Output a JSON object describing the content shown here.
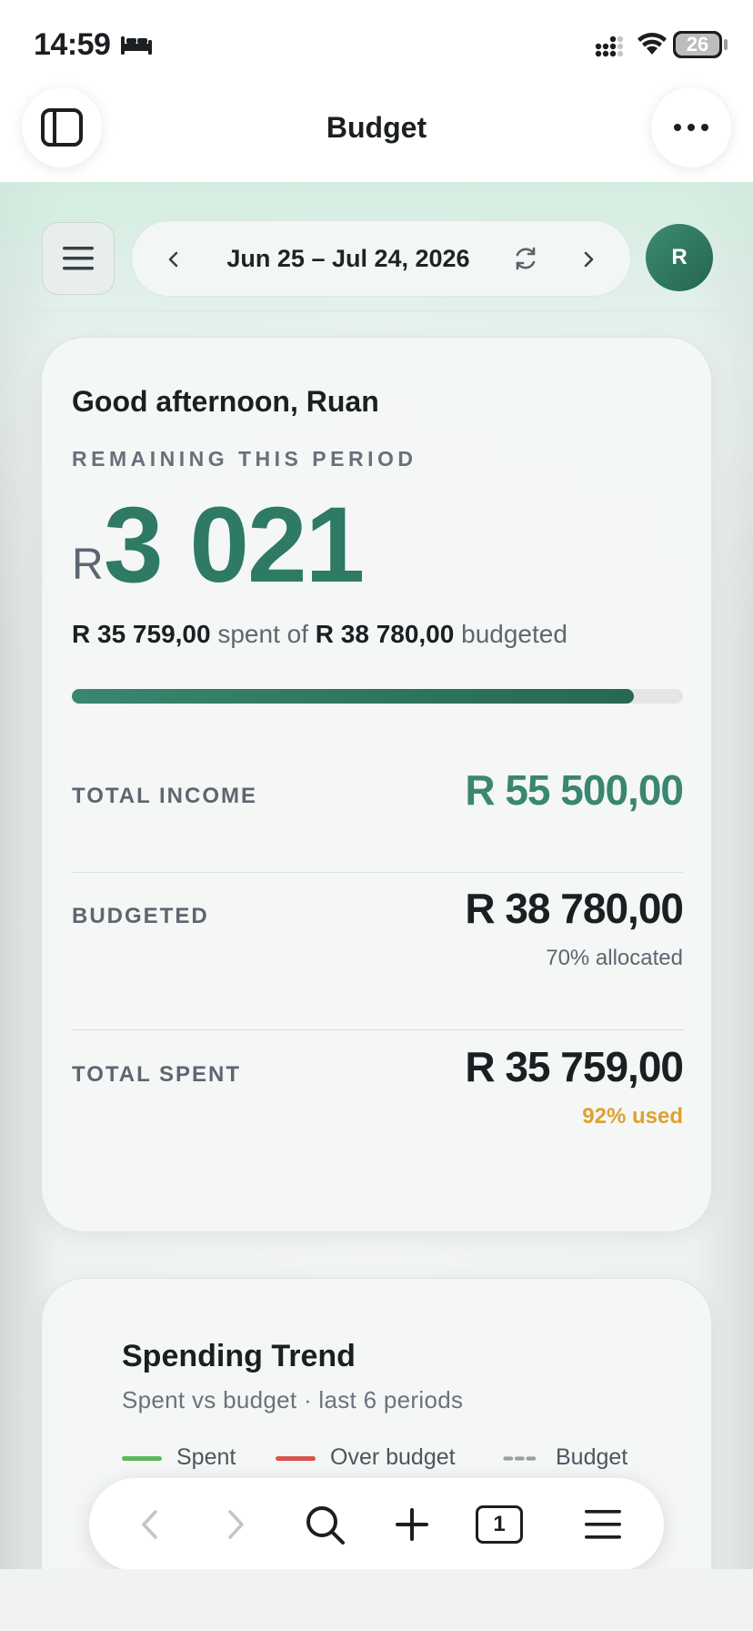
{
  "status_bar": {
    "time": "14:59",
    "battery": "26"
  },
  "browser": {
    "title": "Budget"
  },
  "app_bar": {
    "period": "Jun 25 – Jul 24, 2026",
    "avatar_initial": "R"
  },
  "summary": {
    "greeting": "Good afternoon, Ruan",
    "remaining_label": "REMAINING THIS PERIOD",
    "remaining_currency": "R",
    "remaining_amount": "3 021",
    "spent_amount": "R 35 759,00",
    "spent_of": " spent of ",
    "budgeted_amount": "R 38 780,00",
    "budgeted_word": " budgeted",
    "progress_fraction": 0.92,
    "stats": [
      {
        "label": "TOTAL INCOME",
        "value": "R 55 500,00",
        "sub": ""
      },
      {
        "label": "BUDGETED",
        "value": "R 38 780,00",
        "sub": "70% allocated"
      },
      {
        "label": "TOTAL SPENT",
        "value": "R 35 759,00",
        "sub": "92% used"
      }
    ]
  },
  "trend": {
    "title": "Spending Trend",
    "subtitle": "Spent vs budget · last 6 periods",
    "legend": [
      {
        "label": "Spent",
        "color": "#5cb85c"
      },
      {
        "label": "Over budget",
        "color": "#d9534f"
      },
      {
        "label": "Budget",
        "color": "#9aa0a6"
      }
    ]
  },
  "toolbar": {
    "tab_count": "1"
  },
  "colors": {
    "accent": "#2f7a64",
    "income": "#3a8670",
    "warning": "#e0a030",
    "text": "#1c1f22"
  }
}
